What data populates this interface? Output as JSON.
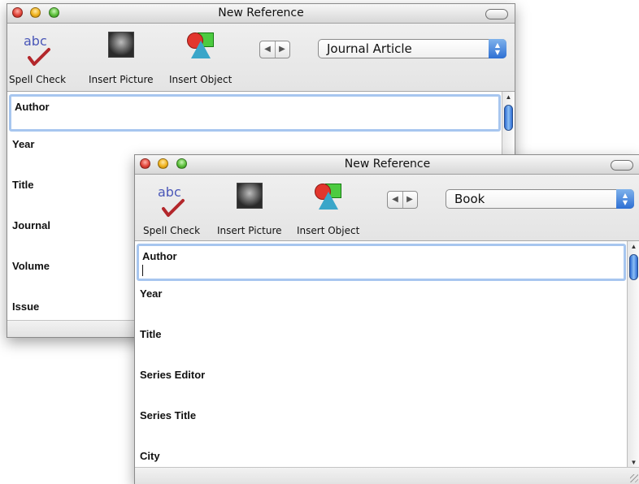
{
  "back_window": {
    "title": "New Reference",
    "toolbar": {
      "spell_check_label": "Spell Check",
      "spell_check_icon_text": "abc",
      "insert_picture_label": "Insert Picture",
      "insert_object_label": "Insert Object",
      "reference_type": "Journal Article"
    },
    "fields": [
      "Author",
      "Year",
      "Title",
      "Journal",
      "Volume",
      "Issue"
    ]
  },
  "front_window": {
    "title": "New Reference",
    "toolbar": {
      "spell_check_label": "Spell Check",
      "spell_check_icon_text": "abc",
      "insert_picture_label": "Insert Picture",
      "insert_object_label": "Insert Object",
      "reference_type": "Book"
    },
    "fields": [
      "Author",
      "Year",
      "Title",
      "Series Editor",
      "Series Title",
      "City"
    ]
  },
  "icons": {
    "nav_prev": "◀",
    "nav_next": "▶",
    "popup_arrows": "▲▼",
    "scroll_up": "▲",
    "scroll_down": "▼"
  },
  "colors": {
    "accent_blue": "#2d6fd3",
    "focus_ring": "#a7c6ef",
    "close_red": "#e0443a",
    "minimize_yellow": "#f0b21c",
    "zoom_green": "#5bbf3a"
  }
}
